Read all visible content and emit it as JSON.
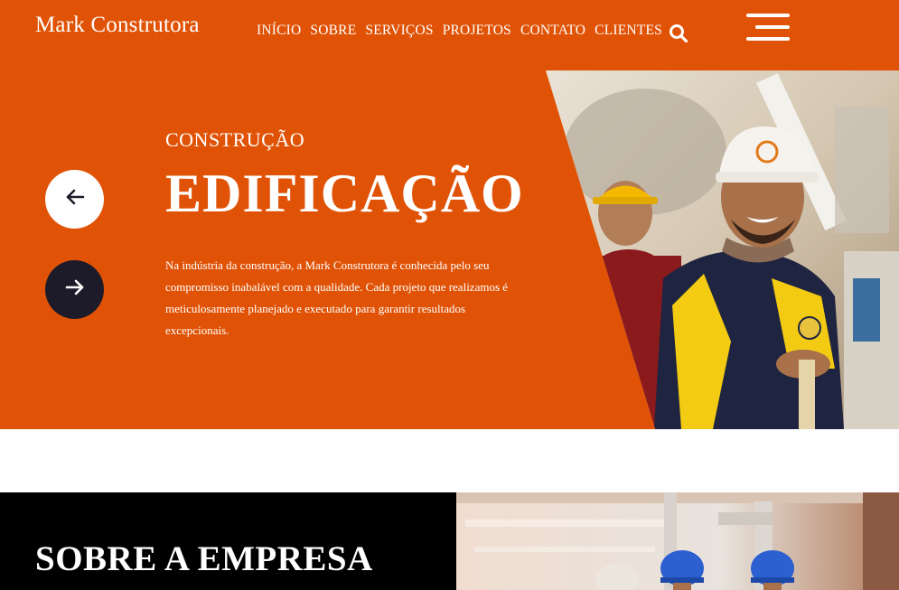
{
  "header": {
    "logo": "Mark Construtora",
    "nav": [
      "INÍCIO",
      "SOBRE",
      "SERVIÇOS",
      "PROJETOS",
      "CONTATO",
      "CLIENTES"
    ],
    "icons": {
      "search": "search-icon",
      "menu": "hamburger-menu-icon"
    }
  },
  "hero": {
    "subtitle": "CONSTRUÇÃO",
    "title": "EDIFICAÇÃO",
    "description": "Na indústria da construção, a Mark Construtora é conhecida pelo seu compromisso inabalável com a qualidade. Cada projeto que realizamos é meticulosamente planejado e executado para garantir resultados excepcionais.",
    "icons": {
      "prev": "arrow-left-icon",
      "next": "arrow-right-icon"
    }
  },
  "about": {
    "title": "SOBRE A EMPRESA"
  },
  "colors": {
    "primary": "#e05306",
    "dark": "#1d1b2a",
    "black": "#000000",
    "white": "#ffffff"
  }
}
